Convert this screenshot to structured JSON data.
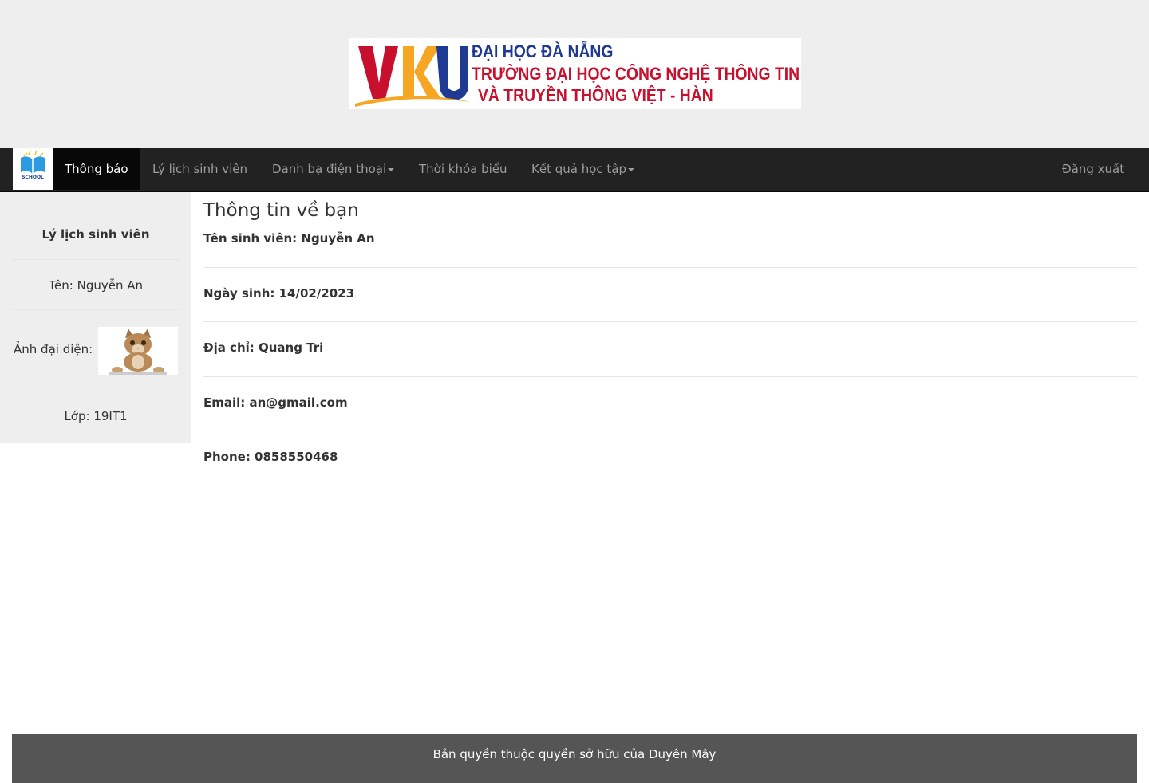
{
  "banner": {
    "logo_text": "VKU",
    "line1": "ĐẠI HỌC ĐÀ NẴNG",
    "line2": "TRƯỜNG ĐẠI HỌC CÔNG NGHỆ THÔNG TIN",
    "line3": "VÀ TRUYỀN THÔNG VIỆT - HÀN"
  },
  "navbar": {
    "brand_text": "SCHOOL",
    "items": [
      {
        "label": "Thông báo",
        "active": true
      },
      {
        "label": "Lý lịch sinh viên"
      },
      {
        "label": "Danh bạ điện thoại",
        "dropdown": true
      },
      {
        "label": "Thời khóa biểu"
      },
      {
        "label": "Kết quả học tập",
        "dropdown": true
      }
    ],
    "logout": "Đăng xuất"
  },
  "sidebar": {
    "title": "Lý lịch sinh viên",
    "name": "Tên: Nguyễn An",
    "avatar_label": "Ảnh đại diện:",
    "class": "Lớp: 19IT1"
  },
  "main": {
    "title": "Thông tin về bạn",
    "fields": [
      "Tên sinh viên: Nguyễn An",
      "Ngày sinh: 14/02/2023",
      "Địa chỉ: Quang Tri",
      "Email: an@gmail.com",
      "Phone: 0858550468"
    ]
  },
  "footer": {
    "text": "Bản quyền thuộc quyền sở hữu của Duyên Mây"
  },
  "colors": {
    "navbar_bg": "#222222",
    "active_bg": "#080808",
    "header_bg": "#eeeeee",
    "footer_bg": "#555555",
    "vku_red": "#c8102e",
    "vku_blue": "#1f3a93",
    "vku_orange": "#f5a623"
  }
}
